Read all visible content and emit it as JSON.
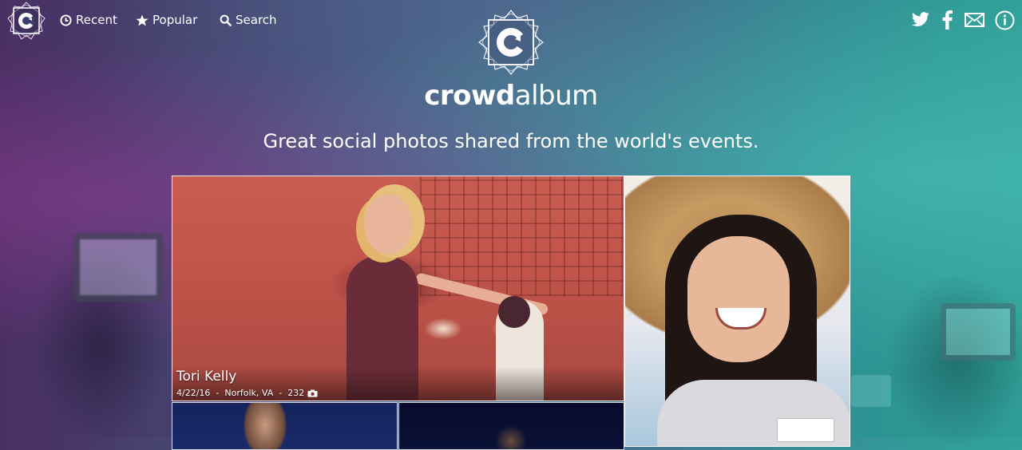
{
  "nav": {
    "recent_label": "Recent",
    "popular_label": "Popular",
    "search_label": "Search",
    "icons": [
      "recent-clock-icon",
      "star-icon",
      "search-icon"
    ]
  },
  "social": [
    "twitter-icon",
    "facebook-icon",
    "mail-icon",
    "info-icon"
  ],
  "hero": {
    "brand_bold": "crowd",
    "brand_light": "album",
    "tagline": "Great social photos shared from the world's events."
  },
  "featured": {
    "title": "Tori Kelly",
    "date": "4/22/16",
    "location": "Norfolk, VA",
    "photo_count": "232",
    "count_icon": "camera-icon"
  },
  "colors": {
    "background_left": "#4a2f63",
    "background_right": "#2f9d95",
    "text": "#ffffff"
  }
}
